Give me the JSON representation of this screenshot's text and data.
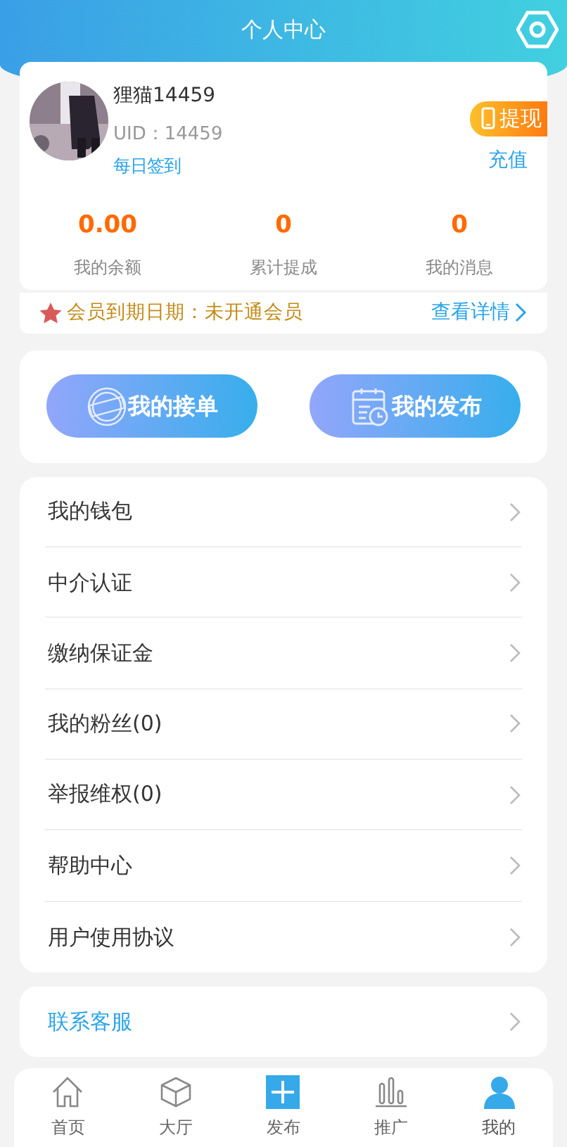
{
  "header": {
    "title": "个人中心"
  },
  "profile": {
    "name": "狸猫14459",
    "uid": "UID：14459",
    "checkin": "每日签到",
    "withdraw": "提现",
    "recharge": "充值"
  },
  "stats": [
    {
      "value": "0.00",
      "label": "我的余额"
    },
    {
      "value": "0",
      "label": "累计提成"
    },
    {
      "value": "0",
      "label": "我的消息"
    }
  ],
  "membership": {
    "text": "会员到期日期：未开通会员",
    "link": "查看详情"
  },
  "actions": [
    {
      "kind": "orders",
      "label": "我的接单"
    },
    {
      "kind": "posts",
      "label": "我的发布"
    }
  ],
  "menu": [
    {
      "label": "我的钱包"
    },
    {
      "label": "中介认证"
    },
    {
      "label": "缴纳保证金"
    },
    {
      "label": "我的粉丝(0)"
    },
    {
      "label": "举报维权(0)"
    },
    {
      "label": "帮助中心"
    },
    {
      "label": "用户使用协议"
    }
  ],
  "contact": {
    "label": "联系客服"
  },
  "tabbar": [
    {
      "kind": "home",
      "label": "首页",
      "selected": false
    },
    {
      "kind": "hall",
      "label": "大厅",
      "selected": false
    },
    {
      "kind": "post",
      "label": "发布",
      "selected": false
    },
    {
      "kind": "promo",
      "label": "推广",
      "selected": false
    },
    {
      "kind": "me",
      "label": "我的",
      "selected": true
    }
  ]
}
